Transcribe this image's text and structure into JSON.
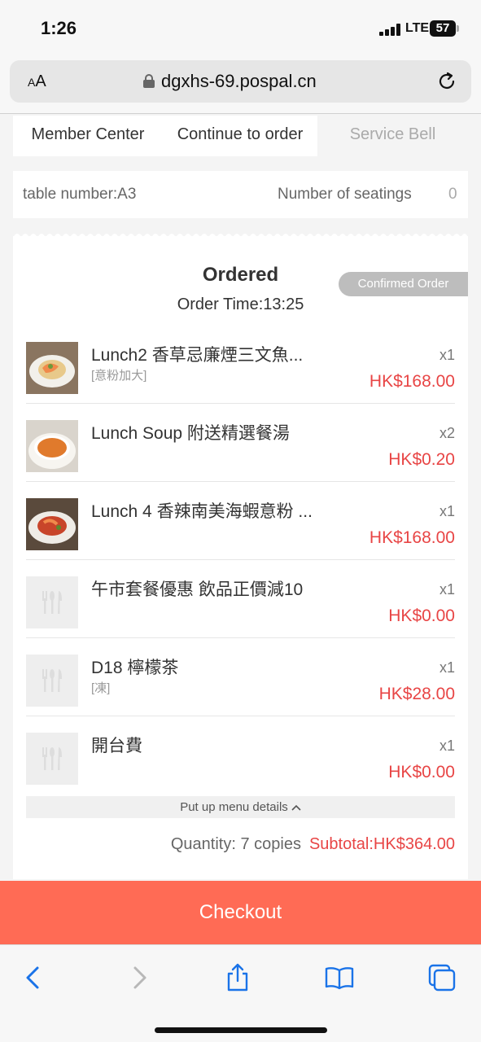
{
  "status_bar": {
    "time": "1:26",
    "network": "LTE",
    "battery": "57"
  },
  "browser": {
    "text_size_label": "AA",
    "url": "dgxhs-69.pospal.cn"
  },
  "tabs": [
    {
      "label": "Member Center"
    },
    {
      "label": "Continue to order"
    },
    {
      "label": "Service Bell"
    }
  ],
  "table_info": {
    "table_number": "table number:A3",
    "seatings_label": "Number of seatings",
    "seatings_value": "0"
  },
  "order": {
    "title": "Ordered",
    "time": "Order Time:13:25",
    "status_badge": "Confirmed Order",
    "items": [
      {
        "name": "Lunch2 香草忌廉煙三文魚...",
        "note": "[意粉加大]",
        "qty": "x1",
        "price": "HK$168.00",
        "thumb": "salmon-pasta"
      },
      {
        "name": "Lunch Soup 附送精選餐湯",
        "note": "",
        "qty": "x2",
        "price": "HK$0.20",
        "thumb": "soup"
      },
      {
        "name": "Lunch 4 香辣南美海蝦意粉 ...",
        "note": "",
        "qty": "x1",
        "price": "HK$168.00",
        "thumb": "shrimp-pasta"
      },
      {
        "name": "午市套餐優惠 飲品正價減10",
        "note": "",
        "qty": "x1",
        "price": "HK$0.00",
        "thumb": "cutlery-placeholder"
      },
      {
        "name": "D18 檸檬茶",
        "note": "[凍]",
        "qty": "x1",
        "price": "HK$28.00",
        "thumb": "cutlery-placeholder"
      },
      {
        "name": "開台費",
        "note": "",
        "qty": "x1",
        "price": "HK$0.00",
        "thumb": "cutlery-placeholder"
      }
    ],
    "put_up_label": "Put up menu details",
    "quantity_label": "Quantity: 7 copies",
    "subtotal_label": "Subtotal:HK$364.00"
  },
  "checkout_label": "Checkout",
  "colors": {
    "accent": "#ff6b55",
    "price": "#e84545"
  }
}
